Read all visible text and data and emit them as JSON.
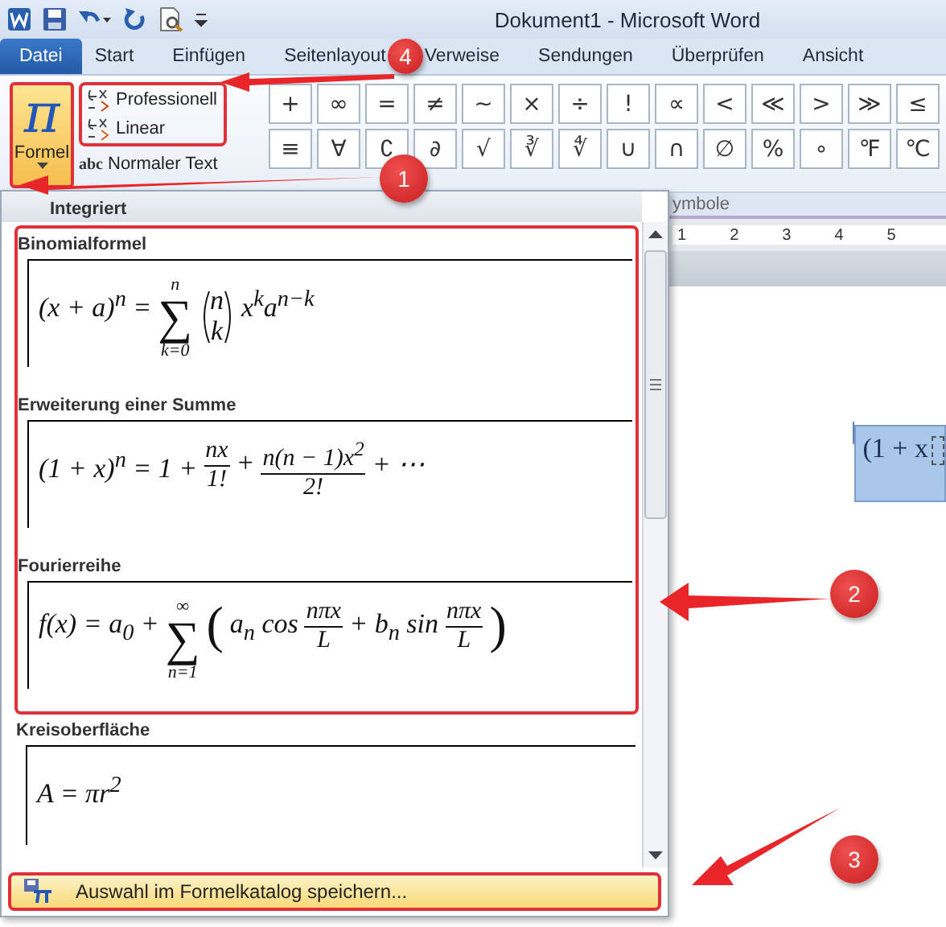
{
  "window": {
    "title": "Dokument1  -  Microsoft Word"
  },
  "tabs": [
    {
      "label": "Datei",
      "kind": "file",
      "selected": false
    },
    {
      "label": "Start",
      "kind": "tab",
      "selected": false
    },
    {
      "label": "Einfügen",
      "kind": "tab",
      "selected": false
    },
    {
      "label": "Seitenlayout",
      "kind": "tab",
      "selected": false
    },
    {
      "label": "Verweise",
      "kind": "tab",
      "selected": false
    },
    {
      "label": "Sendungen",
      "kind": "tab",
      "selected": false
    },
    {
      "label": "Überprüfen",
      "kind": "tab",
      "selected": false
    },
    {
      "label": "Ansicht",
      "kind": "tab",
      "selected": false
    }
  ],
  "ribbon": {
    "formula_button": {
      "icon": "π",
      "label": "Formel",
      "highlighted": true
    },
    "format_group": {
      "highlighted": true,
      "options": [
        {
          "label": "Professionell"
        },
        {
          "label": "Linear"
        }
      ]
    },
    "normal_text": {
      "icon": "abc",
      "label": "Normaler Text"
    },
    "symbols": [
      [
        "+",
        "∞",
        "=",
        "≠",
        "~",
        "×",
        "÷",
        "!",
        "∝",
        "<",
        "≪",
        ">",
        "≫",
        "≤"
      ],
      [
        "≡",
        "∀",
        "∁",
        "∂",
        "√",
        "∛",
        "∜",
        "∪",
        "∩",
        "∅",
        "%",
        "∘",
        "℉",
        "℃"
      ]
    ],
    "group_label": "ymbole"
  },
  "ruler": [
    "1",
    "2",
    "3",
    "4",
    "5"
  ],
  "document": {
    "equation": "(1 + x"
  },
  "gallery": {
    "header": "Integriert",
    "items": [
      {
        "title": "Binomialformel",
        "highlighted": true,
        "formula": [
          {
            "kind": "text",
            "text": "(x + a)$^{n}$ ="
          },
          {
            "kind": "sum",
            "symbol": "∑",
            "upper": "n",
            "lower": "k=0"
          },
          {
            "kind": "binom",
            "top": "n",
            "bottom": "k"
          },
          {
            "kind": "text",
            "text": "x$^{k}$a$^{n−k}$"
          }
        ]
      },
      {
        "title": "Erweiterung einer Summe",
        "highlighted": true,
        "formula": [
          {
            "kind": "text",
            "text": "(1 + x)$^{n}$ = 1 +"
          },
          {
            "kind": "frac",
            "num": "nx",
            "den": "1!"
          },
          {
            "kind": "text",
            "text": "+"
          },
          {
            "kind": "frac",
            "num": "n(n − 1)x$^{2}$",
            "den": "2!"
          },
          {
            "kind": "text",
            "text": "+ ⋯"
          }
        ]
      },
      {
        "title": "Fourierreihe",
        "highlighted": true,
        "formula": [
          {
            "kind": "text",
            "text": "f(x) = a$_{0}$ +"
          },
          {
            "kind": "sum",
            "symbol": "∑",
            "upper": "∞",
            "lower": "n=1"
          },
          {
            "kind": "paren",
            "text": "("
          },
          {
            "kind": "text",
            "text": "a$_{n}$ cos"
          },
          {
            "kind": "frac",
            "num": "nπx",
            "den": "L"
          },
          {
            "kind": "text",
            "text": "+ b$_{n}$ sin"
          },
          {
            "kind": "frac",
            "num": "nπx",
            "den": "L"
          },
          {
            "kind": "paren",
            "text": ")"
          }
        ]
      },
      {
        "title": "Kreisoberfläche",
        "highlighted": false,
        "formula": [
          {
            "kind": "text",
            "text": "A = πr$^{2}$"
          }
        ]
      }
    ],
    "footer": {
      "label": "Auswahl im Formelkatalog speichern...",
      "highlighted": true
    }
  },
  "callouts": [
    {
      "number": "1"
    },
    {
      "number": "2"
    },
    {
      "number": "3"
    },
    {
      "number": "4"
    }
  ]
}
